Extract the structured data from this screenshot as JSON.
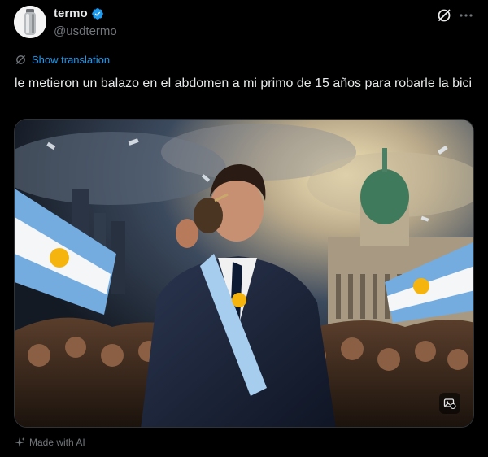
{
  "author": {
    "display_name": "termo",
    "handle": "@usdtermo",
    "verified": true,
    "verified_color": "#1d9bf0"
  },
  "actions": {
    "grok_icon": "grok-icon",
    "more_icon": "more-icon"
  },
  "translation": {
    "label": "Show translation",
    "color": "#1d9bf0"
  },
  "tweet": {
    "text": "le metieron un balazo en el abdomen a mi primo de 15 años para robarle la bici"
  },
  "media": {
    "alt_icon": "image-description-icon"
  },
  "ai_label": {
    "text": "Made with AI",
    "icon": "sparkle-icon"
  },
  "colors": {
    "background": "#000000",
    "text": "#e7e9ea",
    "secondary": "#71767b",
    "accent": "#1d9bf0"
  }
}
